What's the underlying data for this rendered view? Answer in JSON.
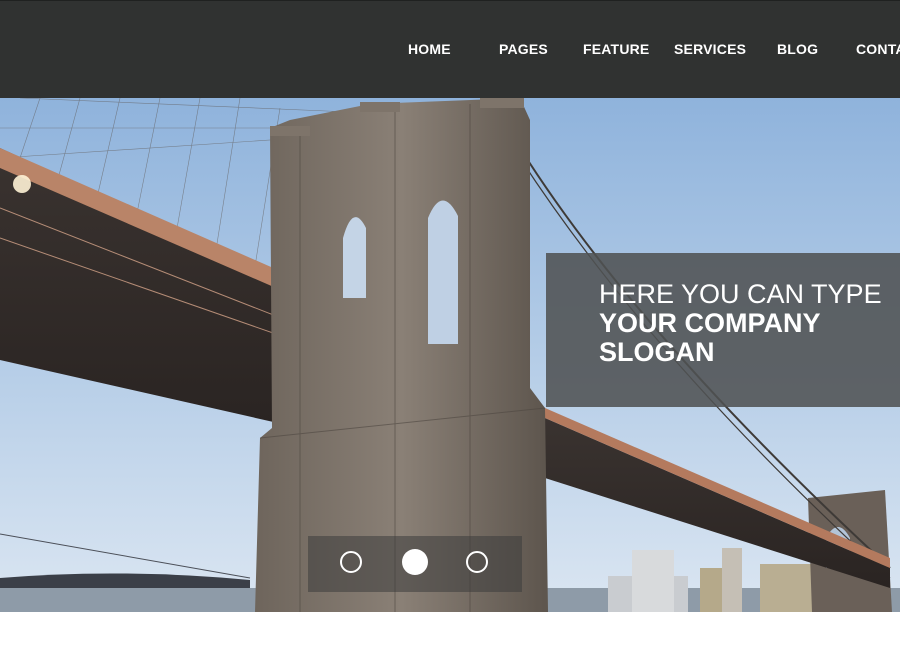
{
  "nav": {
    "items": [
      {
        "label": "HOME"
      },
      {
        "label": "PAGES"
      },
      {
        "label": "FEATURE"
      },
      {
        "label": "SERVICES"
      },
      {
        "label": "BLOG"
      },
      {
        "label": "CONTA"
      }
    ]
  },
  "hero": {
    "slogan": {
      "line1": "HERE YOU CAN TYPE",
      "line2": "YOUR COMPANY",
      "line3": "SLOGAN"
    },
    "slider": {
      "slide_count": 3,
      "active_index": 1
    }
  },
  "colors": {
    "header_bg": "#303231",
    "slogan_bg": "#505253",
    "text": "#ffffff"
  }
}
